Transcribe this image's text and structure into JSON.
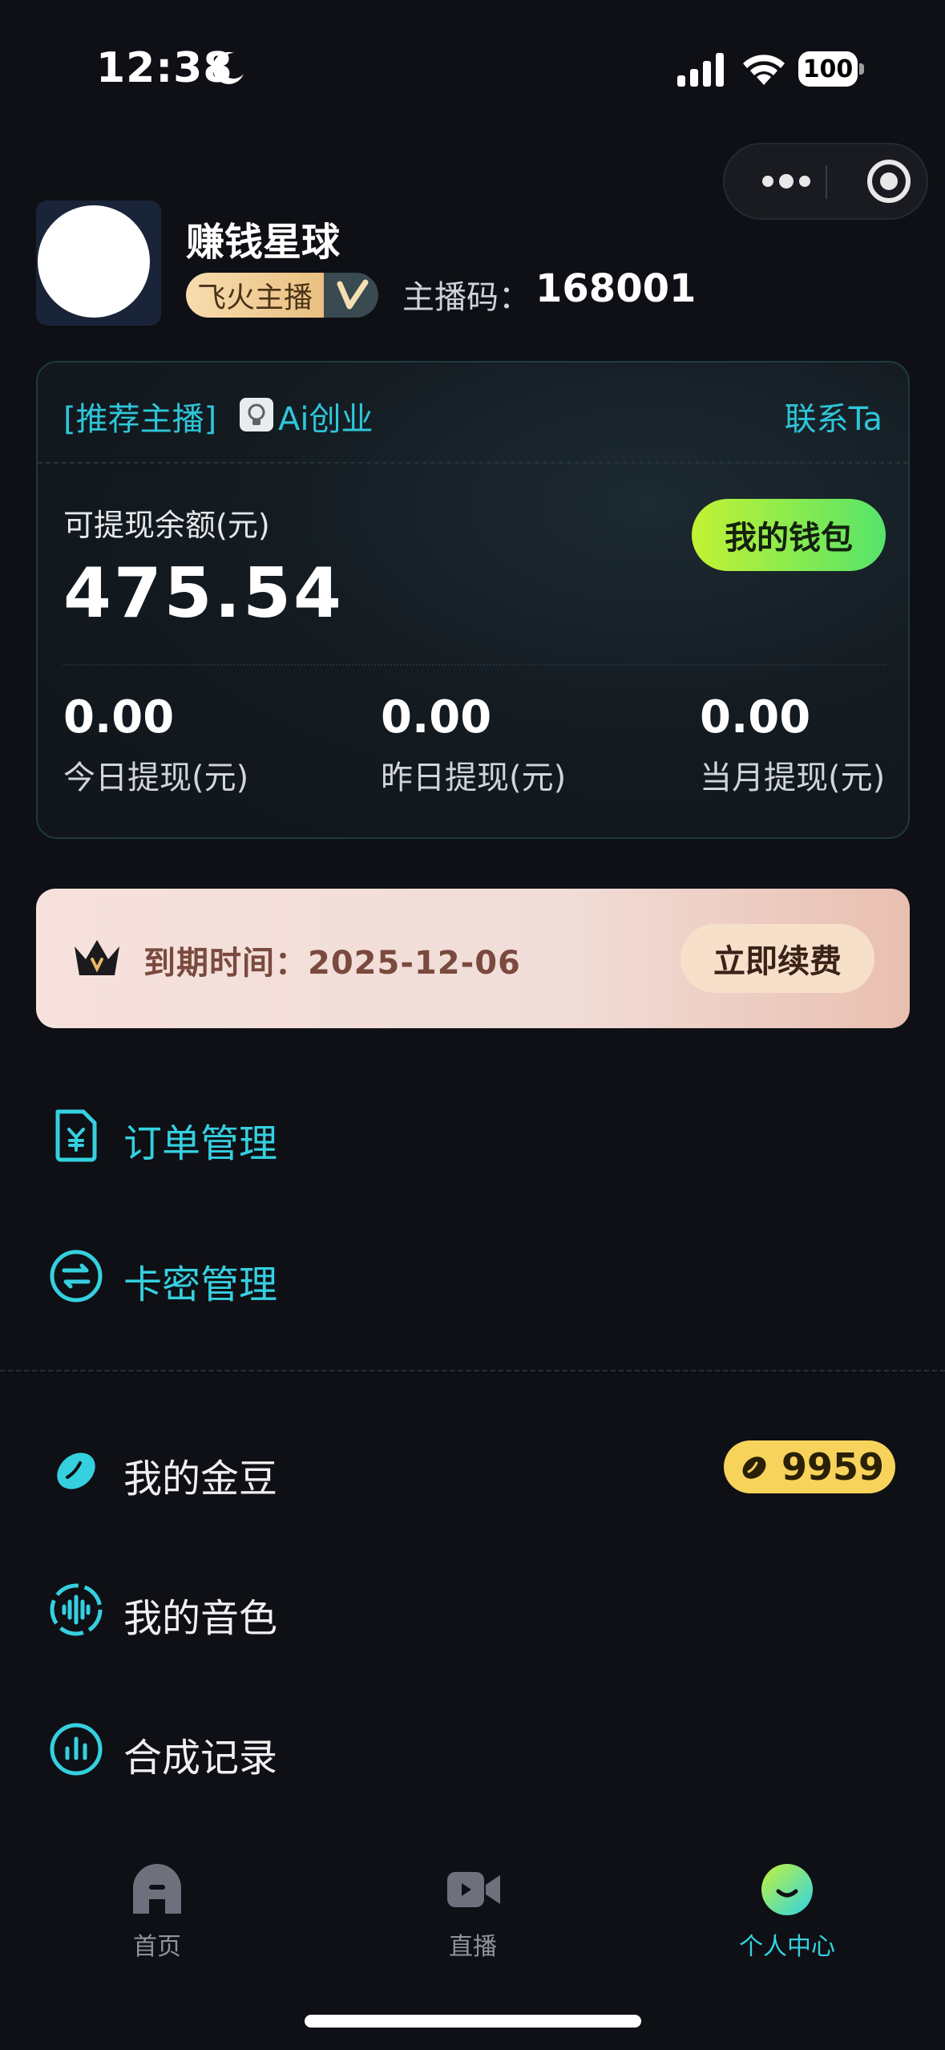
{
  "status_bar": {
    "time": "12:38",
    "battery": "100"
  },
  "profile": {
    "name": "赚钱星球",
    "badge_label": "飞火主播",
    "anchor_code_label": "主播码：",
    "anchor_code": "168001"
  },
  "wallet_card": {
    "recommend_tag": "[推荐主播]",
    "recommend_name": "Ai创业",
    "contact_label": "联系Ta",
    "balance_label": "可提现余额(元)",
    "balance_value": "475.54",
    "wallet_button": "我的钱包",
    "stats": [
      {
        "value": "0.00",
        "label": "今日提现(元)"
      },
      {
        "value": "0.00",
        "label": "昨日提现(元)"
      },
      {
        "value": "0.00",
        "label": "当月提现(元)"
      }
    ]
  },
  "expire_banner": {
    "text": "到期时间：2025-12-06",
    "button": "立即续费"
  },
  "menu": {
    "orders": "订单管理",
    "card_keys": "卡密管理",
    "beans": "我的金豆",
    "beans_count": "9959",
    "voices": "我的音色",
    "records": "合成记录"
  },
  "tab_bar": {
    "home": "首页",
    "live": "直播",
    "profile": "个人中心",
    "active": "profile"
  },
  "colors": {
    "accent": "#35d0e0",
    "background": "#0e1015",
    "wallet_button": "#a8ee44",
    "bean_badge": "#f7d35c"
  },
  "icons": [
    "moon-icon",
    "signal-icon",
    "wifi-icon",
    "battery-icon",
    "more-icon",
    "target-icon",
    "verified-icon",
    "bulb-icon",
    "crown-icon",
    "order-icon",
    "exchange-icon",
    "bean-icon",
    "voice-icon",
    "chart-icon",
    "home-icon",
    "video-icon",
    "smile-icon"
  ]
}
